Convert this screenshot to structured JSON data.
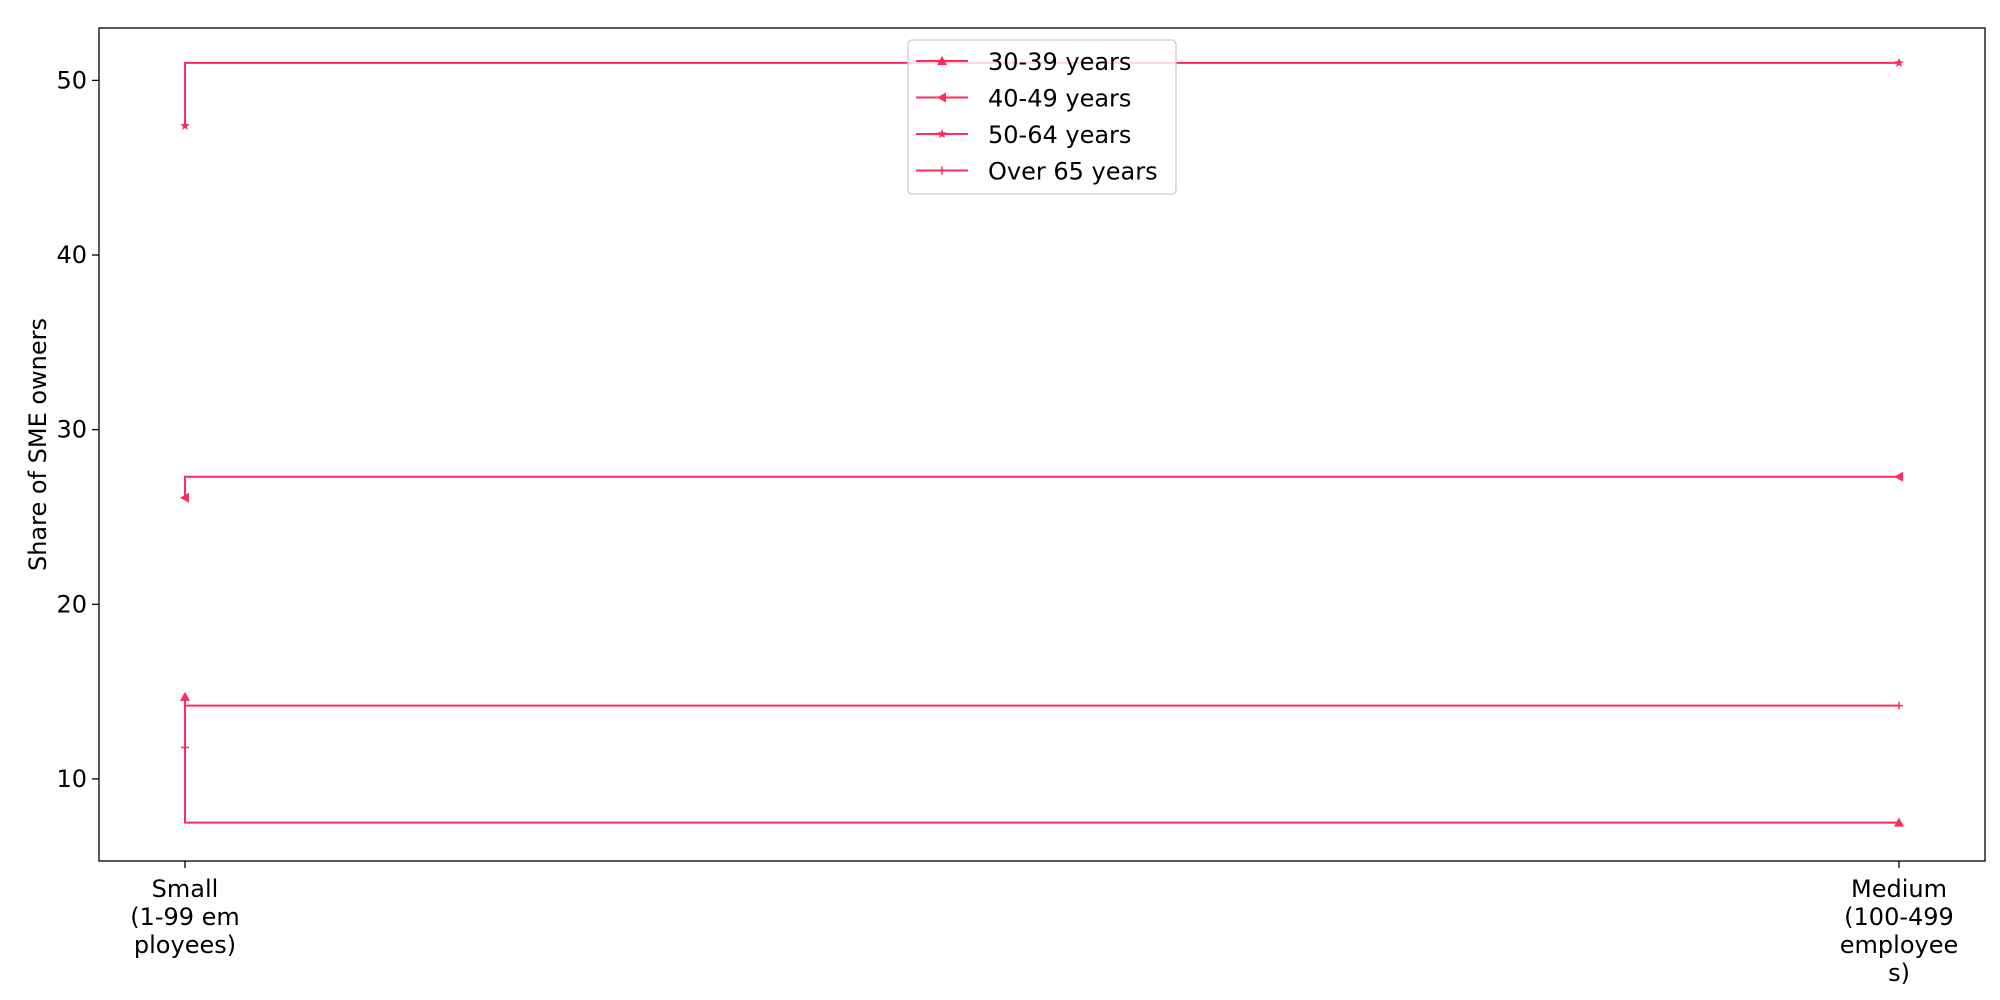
{
  "chart_data": {
    "type": "line",
    "drawstyle": "steps-post",
    "categories": [
      "Small\n(1-99 em\nployees)",
      "Medium\n(100-499\nemployee\ns)"
    ],
    "x_tick_lines": [
      [
        "Small",
        "(1-99 em",
        "ployees)"
      ],
      [
        "Medium",
        "(100-499",
        "employee",
        "s)"
      ]
    ],
    "ylabel": "Share of SME owners",
    "xlabel": "",
    "ylim": [
      5.3,
      53.0
    ],
    "yticks": [
      10,
      20,
      30,
      40,
      50
    ],
    "grid": false,
    "legend_position": "upper center",
    "line_color": "#ff2a5f",
    "series": [
      {
        "name": "30-39 years",
        "marker": "triangle-up",
        "values": [
          14.7,
          7.5
        ]
      },
      {
        "name": "40-49 years",
        "marker": "triangle-left",
        "values": [
          26.1,
          27.3
        ]
      },
      {
        "name": "50-64 years",
        "marker": "star",
        "values": [
          47.4,
          51.0
        ]
      },
      {
        "name": "Over 65 years",
        "marker": "plus",
        "values": [
          11.8,
          14.2
        ]
      }
    ]
  }
}
